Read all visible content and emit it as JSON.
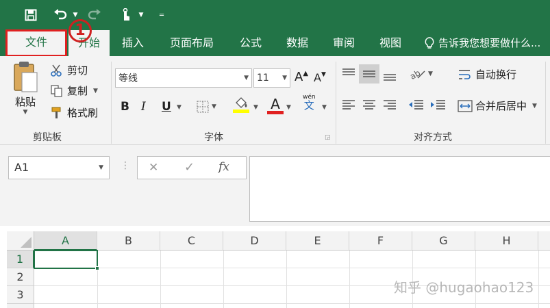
{
  "quick_access": {
    "save_icon": "save-icon",
    "undo_icon": "undo-icon",
    "redo_icon": "redo-icon",
    "touch_icon": "touch-mode-icon",
    "customize_icon": "customize-icon"
  },
  "tabs": [
    {
      "label": "文件",
      "active": true
    },
    {
      "label": "开始"
    },
    {
      "label": "插入"
    },
    {
      "label": "页面布局"
    },
    {
      "label": "公式"
    },
    {
      "label": "数据"
    },
    {
      "label": "审阅"
    },
    {
      "label": "视图"
    }
  ],
  "tell_me": "告诉我您想要做什么...",
  "annotation_marker": "1",
  "clipboard": {
    "paste_label": "粘贴",
    "cut_label": "剪切",
    "copy_label": "复制",
    "format_painter_label": "格式刷",
    "group_label": "剪贴板"
  },
  "font": {
    "font_name": "等线",
    "font_size": "11",
    "increase_label": "A",
    "decrease_label": "A",
    "bold": "B",
    "italic": "I",
    "underline": "U",
    "font_color_label": "A",
    "phonetic_top": "wén",
    "phonetic_bottom": "文",
    "group_label": "字体"
  },
  "alignment": {
    "wrap_text_label": "自动换行",
    "merge_center_label": "合并后居中",
    "group_label": "对齐方式"
  },
  "formula_bar": {
    "name_box": "A1",
    "cancel": "✕",
    "enter": "✓",
    "fx": "fx"
  },
  "columns": [
    "A",
    "B",
    "C",
    "D",
    "E",
    "F",
    "G",
    "H"
  ],
  "rows": [
    "1",
    "2",
    "3"
  ],
  "watermark": "知乎 @hugaohao123",
  "colors": {
    "accent": "#227447",
    "highlight_red": "#e02020",
    "selection": "#217346"
  }
}
